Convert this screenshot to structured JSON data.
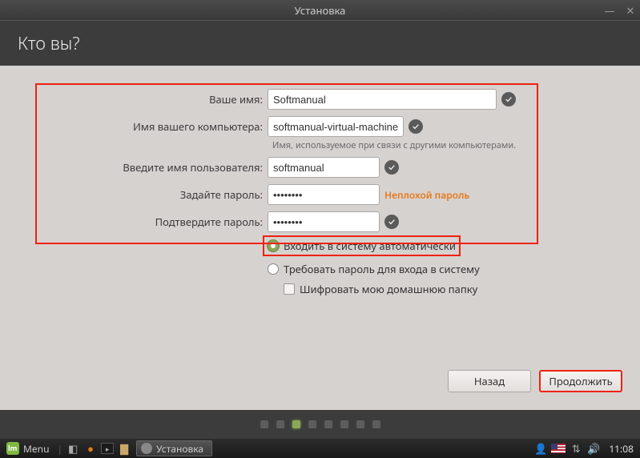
{
  "window": {
    "title": "Установка"
  },
  "header": {
    "title": "Кто вы?"
  },
  "form": {
    "name": {
      "label": "Ваше имя:",
      "value": "Softmanual"
    },
    "host": {
      "label": "Имя вашего компьютера:",
      "value": "softmanual-virtual-machine",
      "hint": "Имя, используемое при связи с другими компьютерами."
    },
    "user": {
      "label": "Введите имя пользователя:",
      "value": "softmanual"
    },
    "pass": {
      "label": "Задайте пароль:",
      "value": "••••••••",
      "strength": "Неплохой пароль"
    },
    "pass2": {
      "label": "Подтвердите пароль:",
      "value": "••••••••"
    }
  },
  "options": {
    "auto": "Входить в систему автоматически",
    "req": "Требовать пароль для входа в систему",
    "enc": "Шифровать мою домашнюю папку"
  },
  "buttons": {
    "back": "Назад",
    "next": "Продолжить"
  },
  "taskbar": {
    "menu": "Menu",
    "active": "Установка",
    "time": "11:08"
  }
}
